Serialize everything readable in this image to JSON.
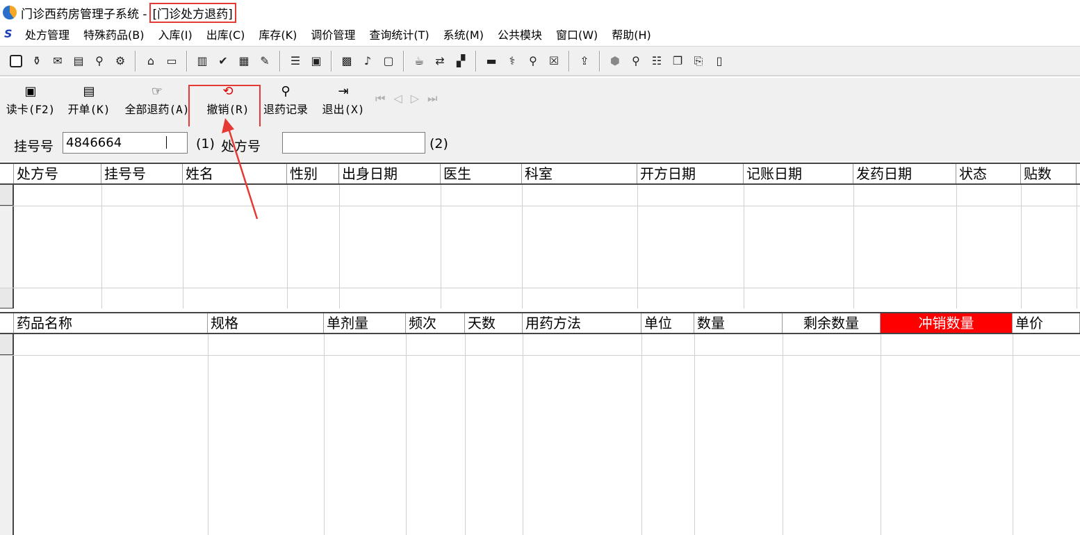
{
  "window": {
    "title": "门诊西药房管理子系统 - ",
    "subtitle": "[门诊处方退药]"
  },
  "menu": {
    "items": [
      "处方管理",
      "特殊药品(B)",
      "入库(I)",
      "出库(C)",
      "库存(K)",
      "调价管理",
      "查询统计(T)",
      "系统(M)",
      "公共模块",
      "窗口(W)",
      "帮助(H)"
    ]
  },
  "actions": {
    "read_card": "读卡(F2)",
    "open_bill": "开单(K)",
    "return_all": "全部退药(A)",
    "cancel": "撤销(R)",
    "return_records": "退药记录",
    "exit": "退出(X)"
  },
  "form": {
    "reg_label": "挂号号",
    "reg_value": "4846664",
    "reg_hint": "(1)",
    "rx_label": "处方号",
    "rx_value": "",
    "rx_hint": "(2)"
  },
  "rx_table": {
    "columns": [
      "处方号",
      "挂号号",
      "姓名",
      "性别",
      "出身日期",
      "医生",
      "科室",
      "开方日期",
      "记账日期",
      "发药日期",
      "状态",
      "贴数"
    ]
  },
  "drug_table": {
    "columns": [
      "药品名称",
      "规格",
      "单剂量",
      "频次",
      "天数",
      "用药方法",
      "单位",
      "数量",
      "剩余数量",
      "冲销数量",
      "单价"
    ]
  },
  "colors": {
    "highlight": "#e53935",
    "red_column": "#ff0000"
  }
}
